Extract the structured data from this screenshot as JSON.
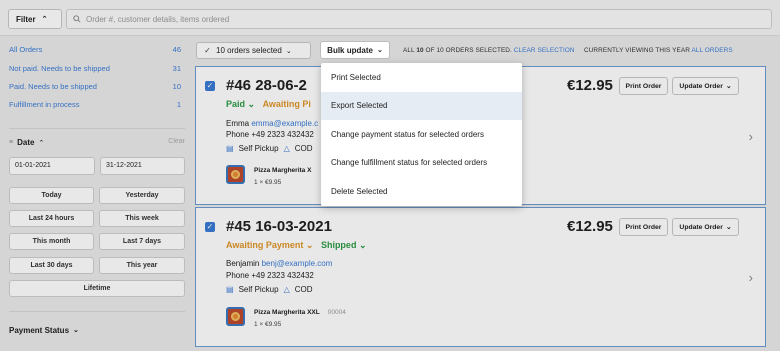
{
  "topbar": {
    "filter_label": "Filter",
    "search_placeholder": "Order #, customer details, items ordered"
  },
  "sidebar": {
    "nav": [
      {
        "label": "All Orders",
        "count": "46"
      },
      {
        "label": "Not paid. Needs to be shipped",
        "count": "31"
      },
      {
        "label": "Paid. Needs to be shipped",
        "count": "10"
      },
      {
        "label": "Fulfillment in process",
        "count": "1"
      }
    ],
    "date_title": "Date",
    "date_clear": "Clear",
    "date_from": "01-01-2021",
    "date_to": "31-12-2021",
    "quick": [
      "Today",
      "Yesterday",
      "Last 24 hours",
      "This week",
      "This month",
      "Last 7 days",
      "Last 30 days",
      "This year",
      "Lifetime"
    ],
    "payment_status": "Payment Status"
  },
  "bulkbar": {
    "selected_label": "10 orders selected",
    "bulk_update": "Bulk update",
    "info_prefix": "ALL",
    "info_count": "10",
    "info_mid": "OF 10 ORDERS SELECTED.",
    "clear_selection": "CLEAR SELECTION",
    "viewing": "CURRENTLY VIEWING THIS YEAR",
    "all_orders": "ALL ORDERS"
  },
  "menu": {
    "items": [
      "Print Selected",
      "Export Selected",
      "Change payment status for selected orders",
      "Change fulfillment status for selected orders",
      "Delete Selected"
    ]
  },
  "orders": [
    {
      "title": "#46  28-06-2",
      "price": "€12.95",
      "print": "Print Order",
      "update": "Update Order",
      "status_a": "Paid",
      "status_b": "Awaiting Pi",
      "name": "Emma",
      "email": "emma@example.c",
      "phone": "Phone +49 2323 432432",
      "shipping": "Self Pickup",
      "payment": "COD",
      "item": "Pizza Margherita X",
      "item_code": "",
      "qty": "1 × €9.95"
    },
    {
      "title": "#45  16-03-2021",
      "price": "€12.95",
      "print": "Print Order",
      "update": "Update Order",
      "status_a": "Awaiting Payment",
      "status_b": "Shipped",
      "name": "Benjamin",
      "email": "benj@example.com",
      "phone": "Phone +49 2323 432432",
      "shipping": "Self Pickup",
      "payment": "COD",
      "item": "Pizza Margherita XXL",
      "item_code": "00004",
      "qty": "1 × €9.95"
    }
  ]
}
